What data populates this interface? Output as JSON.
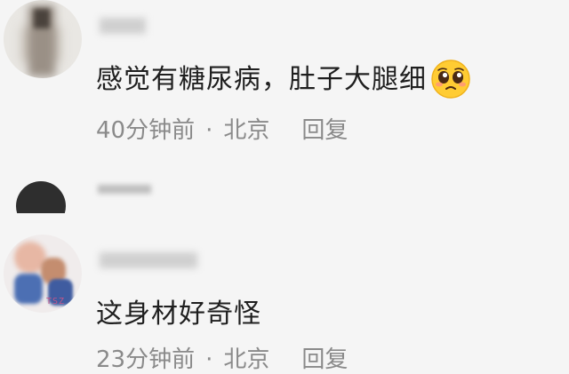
{
  "comments": [
    {
      "text": "感觉有糖尿病，肚子大腿细",
      "emoji": "pleading-face-emoji",
      "time": "40分钟前",
      "separator": "·",
      "location": "北京",
      "reply_label": "回复"
    },
    {
      "text": "这身材好奇怪",
      "avatar_tag": "TSZ",
      "time": "23分钟前",
      "separator": "·",
      "location": "北京",
      "reply_label": "回复"
    }
  ]
}
